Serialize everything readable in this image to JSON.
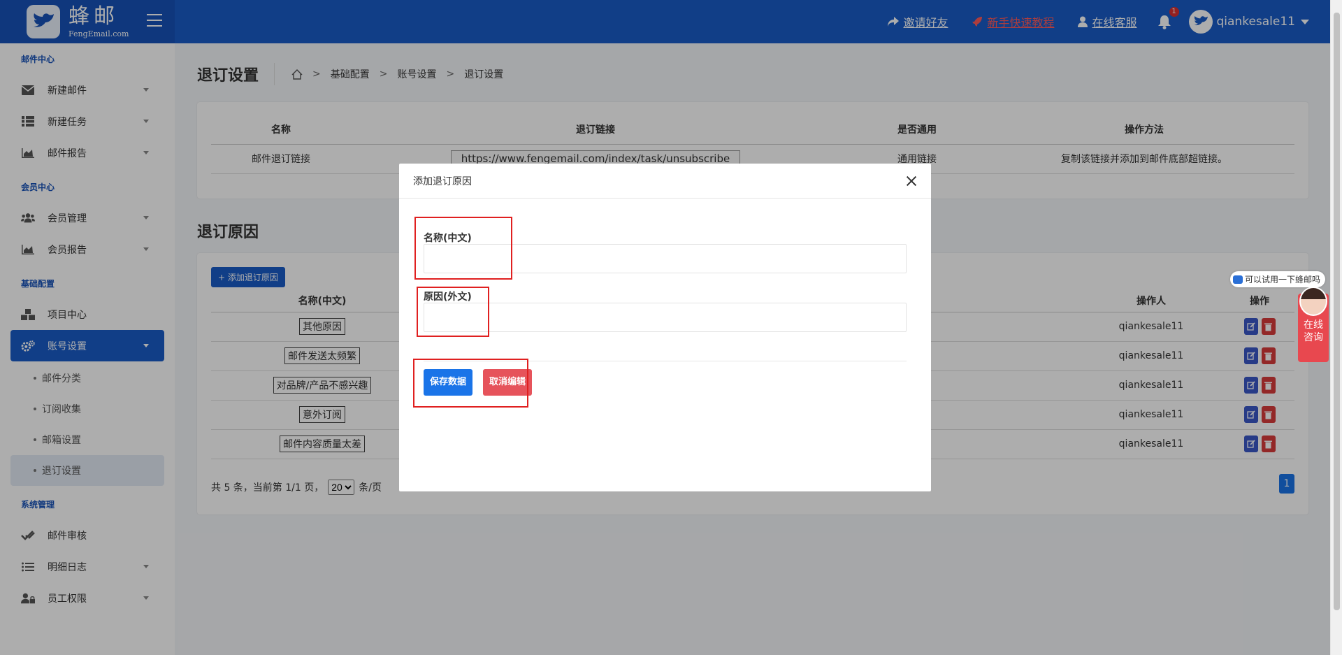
{
  "header": {
    "logo_cn": "蜂邮",
    "logo_en": "FengEmail.com",
    "invite": "邀请好友",
    "tutorial": "新手快速教程",
    "service": "在线客服",
    "bell_count": "1",
    "username": "qiankesale11"
  },
  "sidebar": {
    "sec_mail": "邮件中心",
    "new_mail": "新建邮件",
    "new_task": "新建任务",
    "mail_report": "邮件报告",
    "sec_member": "会员中心",
    "member_manage": "会员管理",
    "member_report": "会员报告",
    "sec_base": "基础配置",
    "project_center": "项目中心",
    "account_settings": "账号设置",
    "sub_mail_category": "邮件分类",
    "sub_subscribe": "订阅收集",
    "sub_mailbox": "邮箱设置",
    "sub_unsubscribe": "退订设置",
    "sec_system": "系统管理",
    "mail_review": "邮件审核",
    "detail_log": "明细日志",
    "staff_perm": "员工权限"
  },
  "page": {
    "title": "退订设置",
    "crumb1": "基础配置",
    "crumb2": "账号设置",
    "crumb3": "退订设置"
  },
  "link_table": {
    "col_name": "名称",
    "col_link": "退订链接",
    "col_general": "是否通用",
    "col_method": "操作方法",
    "row_name": "邮件退订链接",
    "row_link": "https://www.fengemail.com/index/task/unsubscribe",
    "row_general": "通用链接",
    "row_method": "复制该链接并添加到邮件底部超链接。"
  },
  "reasons": {
    "title": "退订原因",
    "add_button": "添加退订原因",
    "col_name": "名称(中文)",
    "col_operator": "操作人",
    "col_action": "操作",
    "rows": [
      {
        "name": "其他原因",
        "operator": "qiankesale11"
      },
      {
        "name": "邮件发送太频繁",
        "operator": "qiankesale11"
      },
      {
        "name": "对品牌/产品不感兴趣",
        "operator": "qiankesale11"
      },
      {
        "name": "意外订阅",
        "operator": "qiankesale11"
      },
      {
        "name": "邮件内容质量太差",
        "operator": "qiankesale11"
      }
    ],
    "pager_text": "共 5 条，当前第 1/1 页，",
    "page_size": "20",
    "page_size_suffix": "条/页",
    "current_page": "1"
  },
  "modal": {
    "title": "添加退订原因",
    "label_name": "名称(中文)",
    "label_reason": "原因(外文)",
    "save": "保存数据",
    "cancel": "取消编辑"
  },
  "chat": {
    "bubble": "可以试用一下蜂邮吗",
    "widget": "在线咨询"
  },
  "colors": {
    "primary": "#1a5cc8",
    "danger": "#e6535b",
    "highlight": "#e02020"
  }
}
